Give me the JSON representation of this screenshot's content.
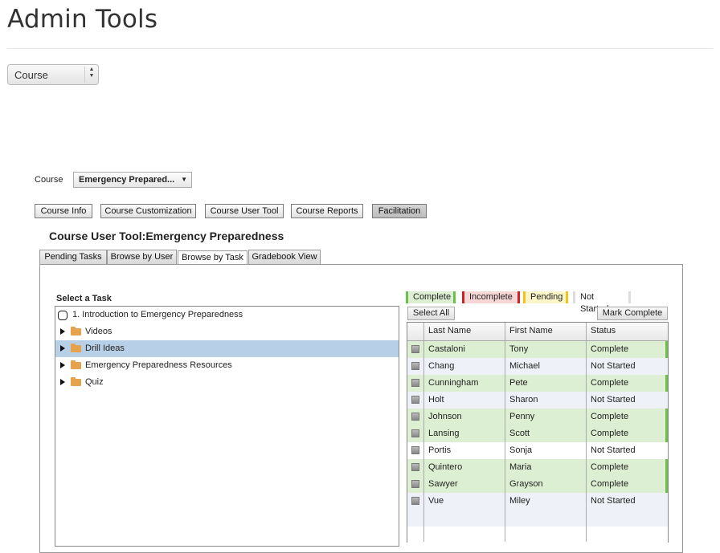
{
  "page": {
    "title": "Admin Tools"
  },
  "top_select": {
    "value": "Course"
  },
  "course": {
    "label": "Course",
    "selected": "Emergency Prepared..."
  },
  "nav_buttons": [
    "Course Info",
    "Course Customization",
    "Course User Tool",
    "Course Reports",
    "Facilitation"
  ],
  "active_button": "Facilitation",
  "tool_title": "Course User Tool:Emergency Preparedness",
  "tabs": [
    "Pending Tasks",
    "Browse by User",
    "Browse by Task",
    "Gradebook View"
  ],
  "active_tab": "Browse by Task",
  "task_panel": {
    "heading": "Select a Task",
    "items": [
      {
        "label": "1.  Introduction to Emergency Preparedness",
        "icon": "circle-icon",
        "expandable": false
      },
      {
        "label": "Videos",
        "icon": "folder-icon",
        "expandable": true
      },
      {
        "label": "Drill Ideas",
        "icon": "folder-icon",
        "expandable": true,
        "selected": true
      },
      {
        "label": "Emergency Preparedness Resources",
        "icon": "folder-icon",
        "expandable": true
      },
      {
        "label": "Quiz",
        "icon": "folder-icon",
        "expandable": true
      }
    ]
  },
  "legend": {
    "items": [
      {
        "label": "Complete",
        "bg": "#dcefd2",
        "edge": "#6cc04a"
      },
      {
        "label": "Incomplete",
        "bg": "#f7d6d6",
        "edge": "#cc2222"
      },
      {
        "label": "Pending",
        "bg": "#fbf5c8",
        "edge": "#f0c419"
      },
      {
        "label": "Not Started",
        "bg": "#ffffff",
        "edge": "#dddddd"
      }
    ]
  },
  "actions": {
    "select_all": "Select All",
    "mark_complete": "Mark Complete"
  },
  "grid": {
    "columns": [
      "Last Name",
      "First Name",
      "Status"
    ],
    "rows": [
      {
        "last": "Castaloni",
        "first": "Tony",
        "status": "Complete"
      },
      {
        "last": "Chang",
        "first": "Michael",
        "status": "Not Started"
      },
      {
        "last": "Cunningham",
        "first": "Pete",
        "status": "Complete"
      },
      {
        "last": "Holt",
        "first": "Sharon",
        "status": "Not Started"
      },
      {
        "last": "Johnson",
        "first": "Penny",
        "status": "Complete"
      },
      {
        "last": "Lansing",
        "first": "Scott",
        "status": "Complete"
      },
      {
        "last": "Portis",
        "first": "Sonja",
        "status": "Not Started"
      },
      {
        "last": "Quintero",
        "first": "Maria",
        "status": "Complete"
      },
      {
        "last": "Sawyer",
        "first": "Grayson",
        "status": "Complete"
      },
      {
        "last": "Vue",
        "first": "Miley",
        "status": "Not Started"
      }
    ]
  },
  "colors": {
    "complete_bg": "#dcefd2",
    "complete_edge": "#6cc04a",
    "alt_row_bg": "#eef2f8",
    "selected_task_bg": "#b8cfe8"
  }
}
